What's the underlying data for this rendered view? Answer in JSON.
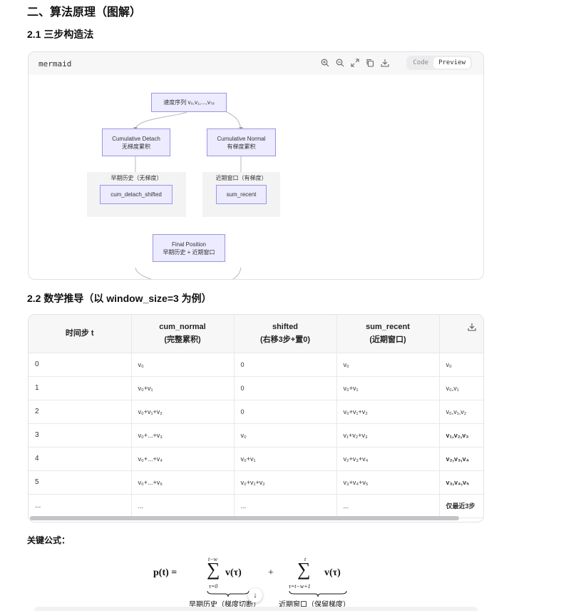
{
  "headings": {
    "section": "二、算法原理（图解）",
    "sub1": "2.1 三步构造法",
    "sub2": "2.2 数学推导（以 window_size=3 为例）",
    "key": "关键公式："
  },
  "code_block": {
    "language": "mermaid",
    "toolbar": {
      "zoom_in_icon": "zoom-in-icon",
      "zoom_out_icon": "zoom-out-icon",
      "fullscreen_icon": "expand-icon",
      "copy_icon": "copy-icon",
      "download_icon": "download-icon",
      "code_label": "Code",
      "preview_label": "Preview",
      "active_view": "Preview"
    }
  },
  "diagram": {
    "top": "速度序列 v₀,v₁,...,v₇₉",
    "left_line1": "Cumulative Detach",
    "left_line2": "无梯度累积",
    "right_line1": "Cumulative Normal",
    "right_line2": "有梯度累积",
    "sub_left_title": "早期历史（无梯度）",
    "sub_left_node": "cum_detach_shifted",
    "sub_right_title": "近期窗口（有梯度）",
    "sub_right_node": "sum_recent",
    "bottom_line1": "Final Position",
    "bottom_line2": "早期历史 + 近期窗口",
    "colors": {
      "node_fill": "#ecebff",
      "node_border": "#9a95e6",
      "edge": "#b8b8c0",
      "subgraph": "#f3f3f4"
    }
  },
  "table": {
    "headers": [
      [
        "时间步 t"
      ],
      [
        "cum_normal",
        "(完整累积)"
      ],
      [
        "shifted",
        "(右移3步+置0)"
      ],
      [
        "sum_recent",
        "(近期窗口)"
      ],
      [
        ""
      ]
    ],
    "rows": [
      [
        "0",
        "v₀",
        "0",
        "v₀",
        "v₀"
      ],
      [
        "1",
        "v₀+v₁",
        "0",
        "v₀+v₁",
        "v₀,v₁"
      ],
      [
        "2",
        "v₀+v₁+v₂",
        "0",
        "v₀+v₁+v₂",
        "v₀,v₁,v₂"
      ],
      [
        "3",
        "v₀+...+v₃",
        "v₀",
        "v₁+v₂+v₃",
        "v₁,v₂,v₃"
      ],
      [
        "4",
        "v₀+...+v₄",
        "v₀+v₁",
        "v₂+v₃+v₄",
        "v₂,v₃,v₄"
      ],
      [
        "5",
        "v₀+...+v₅",
        "v₀+v₁+v₂",
        "v₃+v₄+v₅",
        "v₃,v₄,v₅"
      ],
      [
        "...",
        "...",
        "...",
        "...",
        "仅最近3步"
      ]
    ],
    "bold_last_col_from_row": 3,
    "download_icon": "download-icon"
  },
  "formula": {
    "lhs": "p(t) =",
    "sum1_upper": "t−w",
    "sum1_lower": "τ=0",
    "sum1_term": "v(τ)",
    "plus": "+",
    "sum2_upper": "t",
    "sum2_lower": "τ=t−w+1",
    "sum2_term": "v(τ)",
    "label1": "早期历史（梯度切断）",
    "label2": "近期窗口（保留梯度）"
  },
  "scroll_button": "arrow-down-icon"
}
